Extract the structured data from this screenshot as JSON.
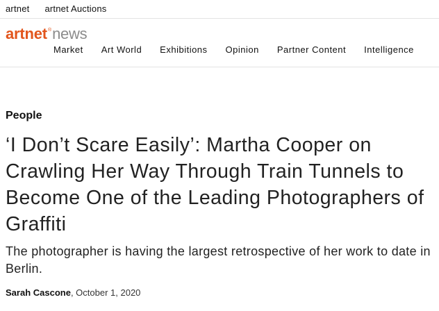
{
  "topbar": {
    "links": [
      "artnet",
      "artnet Auctions"
    ]
  },
  "logo": {
    "brand": "artnet",
    "registered": "®",
    "sub": "news"
  },
  "nav": {
    "items": [
      "Market",
      "Art World",
      "Exhibitions",
      "Opinion",
      "Partner Content",
      "Intelligence"
    ]
  },
  "article": {
    "category": "People",
    "headline": "‘I Don’t Scare Easily’: Martha Cooper on Crawling Her Way Through Train Tunnels to Become One of the Leading Photographers of Graffiti",
    "dek": "The photographer is having the largest retrospective of her work to date in Berlin.",
    "author": "Sarah Cascone",
    "date_sep": ", ",
    "date": "October 1, 2020"
  },
  "colors": {
    "brand": "#e2551c",
    "sub_logo": "#8c8c8c"
  }
}
